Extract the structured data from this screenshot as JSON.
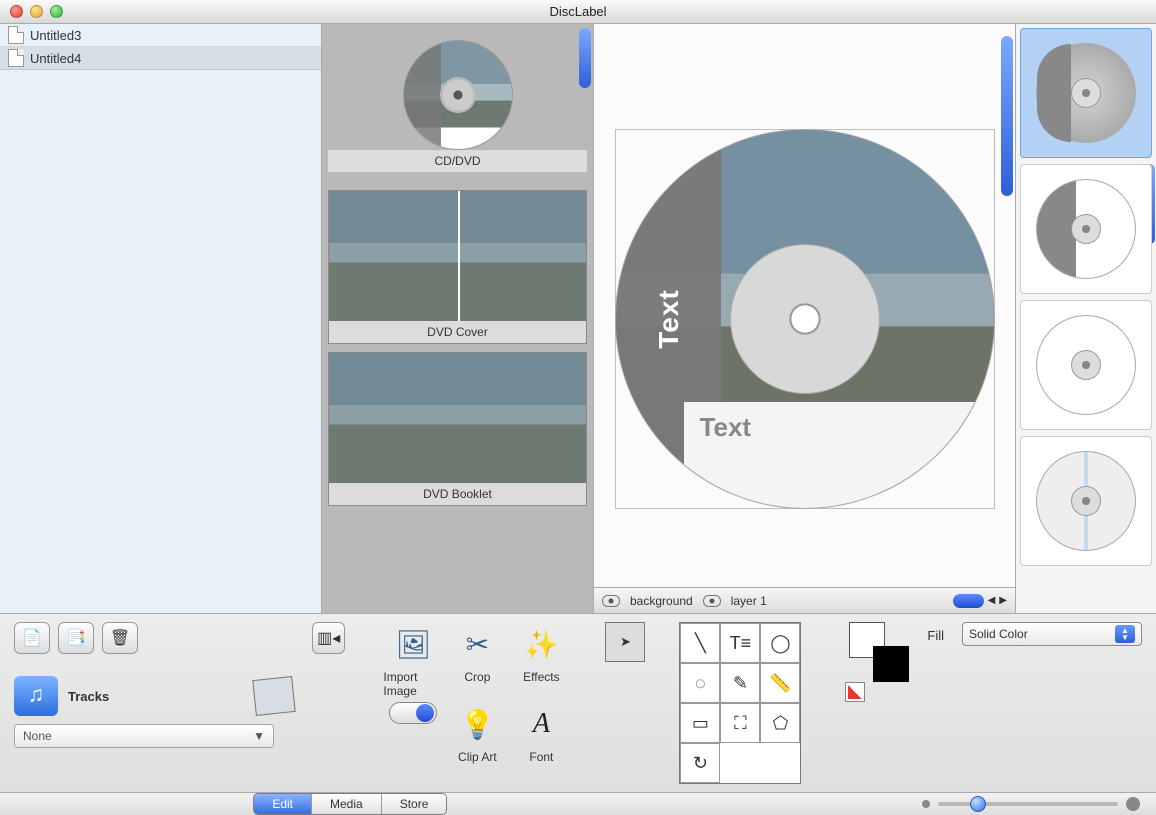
{
  "window": {
    "title": "DiscLabel"
  },
  "files": [
    {
      "name": "Untitled3",
      "selected": false
    },
    {
      "name": "Untitled4",
      "selected": true
    }
  ],
  "templates": [
    {
      "label": "CD/DVD"
    },
    {
      "label": "DVD Cover"
    },
    {
      "label": "DVD Booklet"
    }
  ],
  "canvas": {
    "side_text": "Text",
    "bottom_text": "Text"
  },
  "layers": {
    "bg": "background",
    "l1": "layer 1"
  },
  "tracks": {
    "label": "Tracks",
    "source": "None"
  },
  "tools": {
    "import": "Import Image",
    "crop": "Crop",
    "effects": "Effects",
    "clipart": "Clip Art",
    "font": "Font"
  },
  "fill": {
    "label": "Fill",
    "mode": "Solid Color"
  },
  "tabs": {
    "edit": "Edit",
    "media": "Media",
    "store": "Store"
  }
}
